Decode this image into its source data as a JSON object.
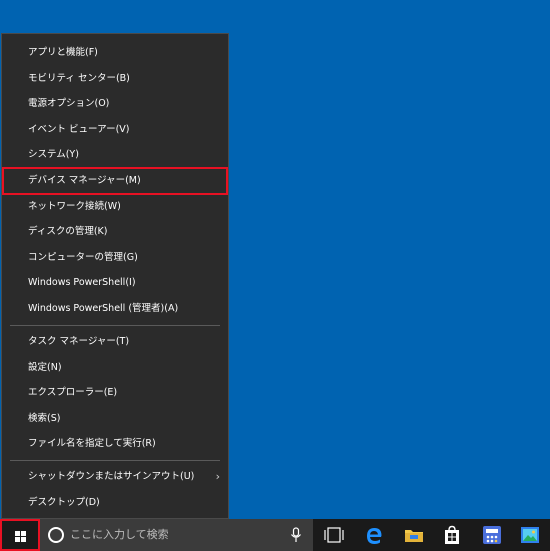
{
  "menu": {
    "items": [
      {
        "label": "アプリと機能(F)"
      },
      {
        "label": "モビリティ センター(B)"
      },
      {
        "label": "電源オプション(O)"
      },
      {
        "label": "イベント ビューアー(V)"
      },
      {
        "label": "システム(Y)"
      },
      {
        "label": "デバイス マネージャー(M)"
      },
      {
        "label": "ネットワーク接続(W)"
      },
      {
        "label": "ディスクの管理(K)"
      },
      {
        "label": "コンピューターの管理(G)"
      },
      {
        "label": "Windows PowerShell(I)"
      },
      {
        "label": "Windows PowerShell (管理者)(A)"
      },
      {
        "label": "タスク マネージャー(T)"
      },
      {
        "label": "設定(N)"
      },
      {
        "label": "エクスプローラー(E)"
      },
      {
        "label": "検索(S)"
      },
      {
        "label": "ファイル名を指定して実行(R)"
      },
      {
        "label": "シャットダウンまたはサインアウト(U)"
      },
      {
        "label": "デスクトップ(D)"
      }
    ]
  },
  "taskbar": {
    "search_placeholder": "ここに入力して検索"
  },
  "colors": {
    "desktop": "#0063b1",
    "menu_bg": "#2b2b2b",
    "highlight": "#e81123",
    "taskbar": "#1a1a1a"
  }
}
